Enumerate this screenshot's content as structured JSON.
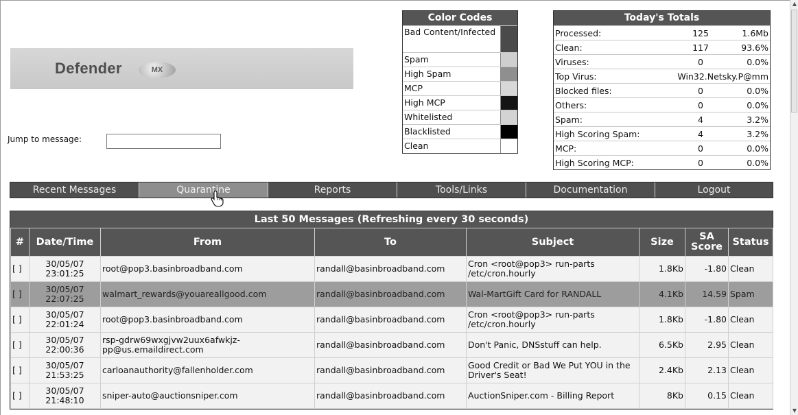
{
  "logo": {
    "text": "Defender",
    "badge": "MX"
  },
  "jump": {
    "label": "Jump to message:",
    "value": ""
  },
  "color_codes": {
    "title": "Color Codes",
    "items": [
      {
        "label": "Bad Content/Infected",
        "color": "#4a4a4a"
      },
      {
        "label": "Spam",
        "color": "#cfcfcf"
      },
      {
        "label": "High Spam",
        "color": "#8f8f8f"
      },
      {
        "label": "MCP",
        "color": "#d8d8d8"
      },
      {
        "label": "High MCP",
        "color": "#141414"
      },
      {
        "label": "Whitelisted",
        "color": "#d3d3d3"
      },
      {
        "label": "Blacklisted",
        "color": "#000000"
      },
      {
        "label": "Clean",
        "color": "#ffffff"
      }
    ]
  },
  "totals": {
    "title": "Today's Totals",
    "rows": [
      {
        "label": "Processed:",
        "count": "125",
        "value": "1.6Mb"
      },
      {
        "label": "Clean:",
        "count": "117",
        "value": "93.6%"
      },
      {
        "label": "Viruses:",
        "count": "0",
        "value": "0.0%"
      },
      {
        "label": "Top Virus:",
        "count": "Win32.Netsky.P@mm",
        "value": ""
      },
      {
        "label": "Blocked files:",
        "count": "0",
        "value": "0.0%"
      },
      {
        "label": "Others:",
        "count": "0",
        "value": "0.0%"
      },
      {
        "label": "Spam:",
        "count": "4",
        "value": "3.2%"
      },
      {
        "label": "High Scoring Spam:",
        "count": "4",
        "value": "3.2%"
      },
      {
        "label": "MCP:",
        "count": "0",
        "value": "0.0%"
      },
      {
        "label": "High Scoring MCP:",
        "count": "0",
        "value": "0.0%"
      }
    ]
  },
  "nav": {
    "tabs": [
      "Recent Messages",
      "Quarantine",
      "Reports",
      "Tools/Links",
      "Documentation",
      "Logout"
    ],
    "active": "Quarantine"
  },
  "messages": {
    "caption": "Last 50 Messages (Refreshing every 30 seconds)",
    "columns": [
      "#",
      "Date/Time",
      "From",
      "To",
      "Subject",
      "Size",
      "SA Score",
      "Status"
    ],
    "rows": [
      {
        "sel": "[ ]",
        "date": "30/05/07",
        "time": "23:01:25",
        "from": "root@pop3.basinbroadband.com",
        "to": "randall@basinbroadband.com",
        "subject": "Cron <root@pop3> run-parts /etc/cron.hourly",
        "size": "1.8Kb",
        "score": "-1.80",
        "status": "Clean"
      },
      {
        "sel": "[ ]",
        "date": "30/05/07",
        "time": "22:07:25",
        "from": "walmart_rewards@youareallgood.com",
        "to": "randall@basinbroadband.com",
        "subject": "Wal-MartGift Card for RANDALL",
        "size": "4.1Kb",
        "score": "14.59",
        "status": "Spam"
      },
      {
        "sel": "[ ]",
        "date": "30/05/07",
        "time": "22:01:24",
        "from": "root@pop3.basinbroadband.com",
        "to": "randall@basinbroadband.com",
        "subject": "Cron <root@pop3> run-parts /etc/cron.hourly",
        "size": "1.8Kb",
        "score": "-1.80",
        "status": "Clean"
      },
      {
        "sel": "[ ]",
        "date": "30/05/07",
        "time": "22:00:36",
        "from": "rsp-gdrw69wxgjvw2uux6afwkjz-pp@us.emaildirect.com",
        "to": "randall@basinbroadband.com",
        "subject": "Don't Panic, DNSstuff can help.",
        "size": "6.5Kb",
        "score": "2.95",
        "status": "Clean"
      },
      {
        "sel": "[ ]",
        "date": "30/05/07",
        "time": "21:53:25",
        "from": "carloanauthority@fallenholder.com",
        "to": "randall@basinbroadband.com",
        "subject": "Good Credit or Bad We Put YOU in the Driver's Seat!",
        "size": "2.4Kb",
        "score": "2.13",
        "status": "Clean"
      },
      {
        "sel": "[ ]",
        "date": "30/05/07",
        "time": "21:48:10",
        "from": "sniper-auto@auctionsniper.com",
        "to": "randall@basinbroadband.com",
        "subject": "AuctionSniper.com - Billing Report",
        "size": "8Kb",
        "score": "0.15",
        "status": "Clean"
      }
    ]
  }
}
